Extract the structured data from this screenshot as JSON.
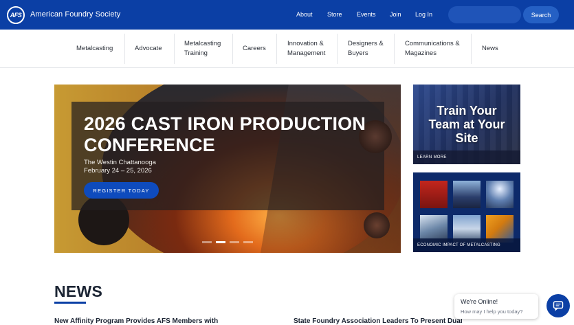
{
  "header": {
    "logo_mark": "AFS",
    "brand": "American Foundry Society",
    "links": [
      "About",
      "Store",
      "Events",
      "Join",
      "Log In"
    ],
    "search_placeholder": "",
    "search_button": "Search"
  },
  "nav": {
    "items": [
      {
        "label": "Metalcasting"
      },
      {
        "label": "Advocate"
      },
      {
        "label": "Metalcasting Training"
      },
      {
        "label": "Careers"
      },
      {
        "label": "Innovation & Management"
      },
      {
        "label": "Designers & Buyers"
      },
      {
        "label": "Communications & Magazines"
      },
      {
        "label": "News"
      }
    ]
  },
  "hero": {
    "title": "2026 CAST IRON PRODUCTION CONFERENCE",
    "venue": "The Westin Chattanooga",
    "dates": "February 24 – 25, 2026",
    "cta": "REGISTER TODAY",
    "slide_count": 4,
    "active_slide": 2
  },
  "side_cards": [
    {
      "title": "Train Your Team at Your Site",
      "footer": "LEARN MORE"
    },
    {
      "title": "",
      "footer": "ECONOMIC IMPACT OF METALCASTING"
    }
  ],
  "news": {
    "heading": "NEWS",
    "items": [
      "New Affinity Program Provides AFS Members with",
      "State Foundry Association Leaders To Present Dual"
    ]
  },
  "chat": {
    "title": "We're Online!",
    "subtitle": "How may I help you today?"
  },
  "colors": {
    "brand_blue": "#0b3fa5",
    "button_blue": "#0e4bbd",
    "text_dark": "#1b2433"
  },
  "icons": {
    "chat": "chat-icon",
    "logo": "afs-logo-icon"
  }
}
